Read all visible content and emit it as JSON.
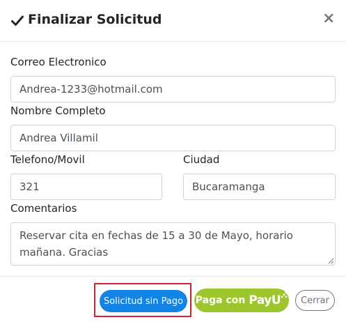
{
  "modal": {
    "title": "Finalizar Solicitud",
    "close_symbol": "×"
  },
  "form": {
    "email": {
      "label": "Correo Electronico",
      "value": "Andrea-1233@hotmail.com"
    },
    "name": {
      "label": "Nombre Completo",
      "value": "Andrea Villamil"
    },
    "phone": {
      "label": "Telefono/Movil",
      "value": "321"
    },
    "city": {
      "label": "Ciudad",
      "value": "Bucaramanga"
    },
    "comments": {
      "label": "Comentarios",
      "value": "Reservar cita en fechas de 15 a 30 de Mayo, horario mañana. Gracias"
    }
  },
  "footer": {
    "sin_pago_label": "Solicitud sin Pago",
    "payu_label": "Paga con",
    "payu_logo_text": "PayU",
    "close_label": "Cerrar"
  },
  "colors": {
    "primary_button": "#1284e6",
    "payu_button": "#9cc62b",
    "highlight_box": "#d72027",
    "close_button_border": "#6c757d"
  },
  "icons": {
    "title_icon": "check-icon",
    "close_icon": "close-icon",
    "resize_icon": "resize-grip-icon"
  }
}
